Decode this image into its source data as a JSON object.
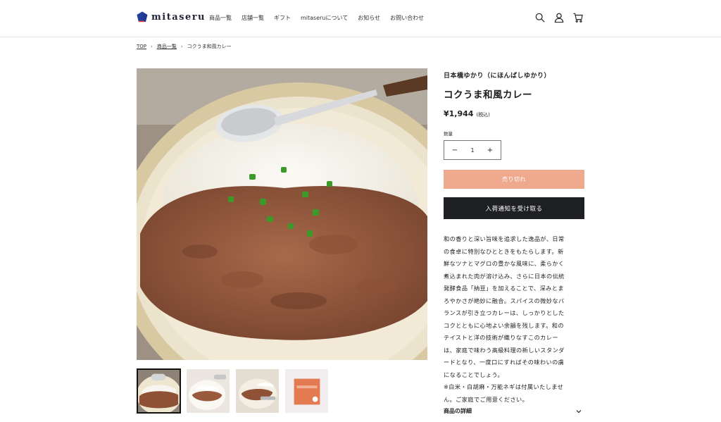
{
  "header": {
    "logo_text": "mitaseru",
    "nav": [
      {
        "label": "商品一覧"
      },
      {
        "label": "店舗一覧"
      },
      {
        "label": "ギフト"
      },
      {
        "label": "mitaseruについて"
      },
      {
        "label": "お知らせ"
      },
      {
        "label": "お問い合わせ"
      }
    ],
    "icons": [
      "search-icon",
      "account-icon",
      "cart-icon"
    ]
  },
  "breadcrumb": {
    "items": [
      "TOP",
      "商品一覧",
      "コクうま和風カレー"
    ],
    "separator": "›"
  },
  "product": {
    "vendor": "日本橋ゆかり（にほんばしゆかり）",
    "title": "コクうま和風カレー",
    "price": "¥1,944",
    "tax_note": "(税込)",
    "quantity_label": "数量",
    "quantity": "1",
    "minus": "−",
    "plus": "+",
    "soldout_label": "売り切れ",
    "notify_label": "入荷通知を受け取る",
    "description_lines": [
      "和の香りと深い旨味を追求した逸品が、日常",
      "の食卓に特別なひとときをもたらします。新",
      "鮮なツナとマグロの豊かな風味に、柔らかく",
      "煮込まれた肉が溶け込み、さらに日本の伝統",
      "発酵食品「納豆」を加えることで、深みとま",
      "ろやかさが絶妙に融合。スパイスの微妙なバ",
      "ランスが引き立つカレーは、しっかりとした",
      "コクとともに心地よい余韻を残します。和の",
      "テイストと洋の技術が織りなすこのカレー",
      "は、家庭で味わう高級料理の新しいスタンダ",
      "ードとなり、一度口にすればその味わいの虜",
      "になることでしょう。",
      "※白米・白胡麻・万能ネギは付属いたしませ",
      "ん。ご家庭でご用意ください。"
    ],
    "accordion_label": "商品の詳細",
    "thumbnail_count": 4
  },
  "colors": {
    "soldout": "#efaa8e",
    "notify": "#1f2023",
    "logo_mark": "#1f3a93",
    "logo_accent": "#e8413c"
  }
}
